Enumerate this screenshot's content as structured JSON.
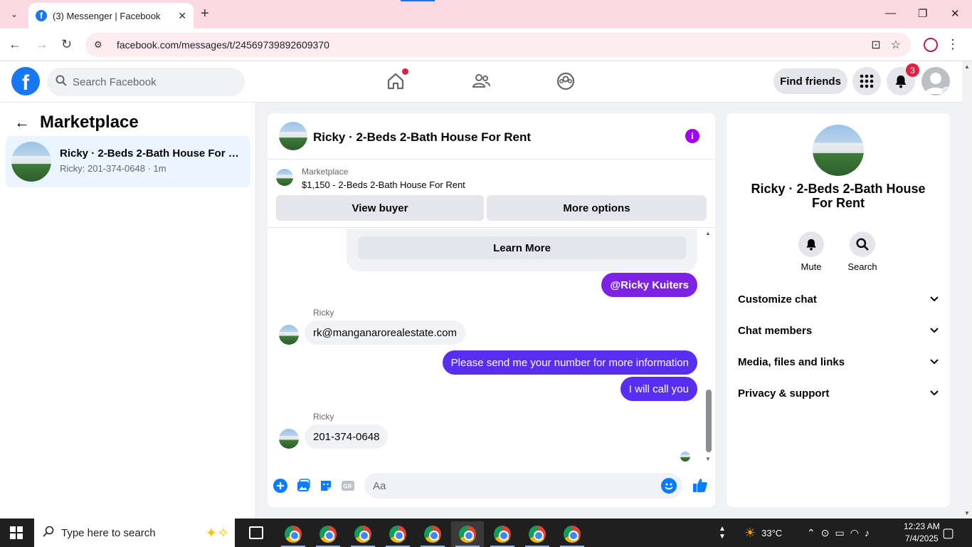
{
  "browser": {
    "tab_title": "(3) Messenger | Facebook",
    "url": "facebook.com/messages/t/24569739892609370"
  },
  "fb": {
    "search_placeholder": "Search Facebook",
    "find_friends": "Find friends",
    "notifications_count": "3"
  },
  "sidebar": {
    "title": "Marketplace",
    "conversation": {
      "name": "Ricky · 2-Beds 2-Bath House For R...",
      "subtitle": "Ricky: 201-374-0648 · 1m"
    }
  },
  "chat": {
    "title": "Ricky · 2-Beds 2-Bath House For Rent",
    "marketplace_label": "Marketplace",
    "listing": "$1,150 - 2-Beds 2-Bath House For Rent",
    "view_buyer": "View buyer",
    "more_options": "More options",
    "learn_more": "Learn More",
    "messages": [
      {
        "direction": "out",
        "text": "@Ricky Kuiters"
      },
      {
        "direction": "in",
        "sender": "Ricky",
        "text": "rk@manganarorealestate.com"
      },
      {
        "direction": "out",
        "text": "Please send me your number for more information"
      },
      {
        "direction": "out",
        "text": "I will call you"
      },
      {
        "direction": "in",
        "sender": "Ricky",
        "text": "201-374-0648"
      }
    ],
    "composer_placeholder": "Aa"
  },
  "info": {
    "name": "Ricky · 2-Beds 2-Bath House For Rent",
    "actions": [
      "Mute",
      "Search"
    ],
    "sections": [
      "Customize chat",
      "Chat members",
      "Media, files and links",
      "Privacy & support"
    ]
  },
  "taskbar": {
    "search_placeholder": "Type here to search",
    "weather": "33°C",
    "time": "12:23 AM",
    "date": "7/4/2025"
  },
  "colors": {
    "fb_blue": "#1877f2",
    "outgoing_bubble": "#5a2ef0",
    "mention_bubble": "#7d22e3",
    "notification_red": "#e41e3f"
  }
}
